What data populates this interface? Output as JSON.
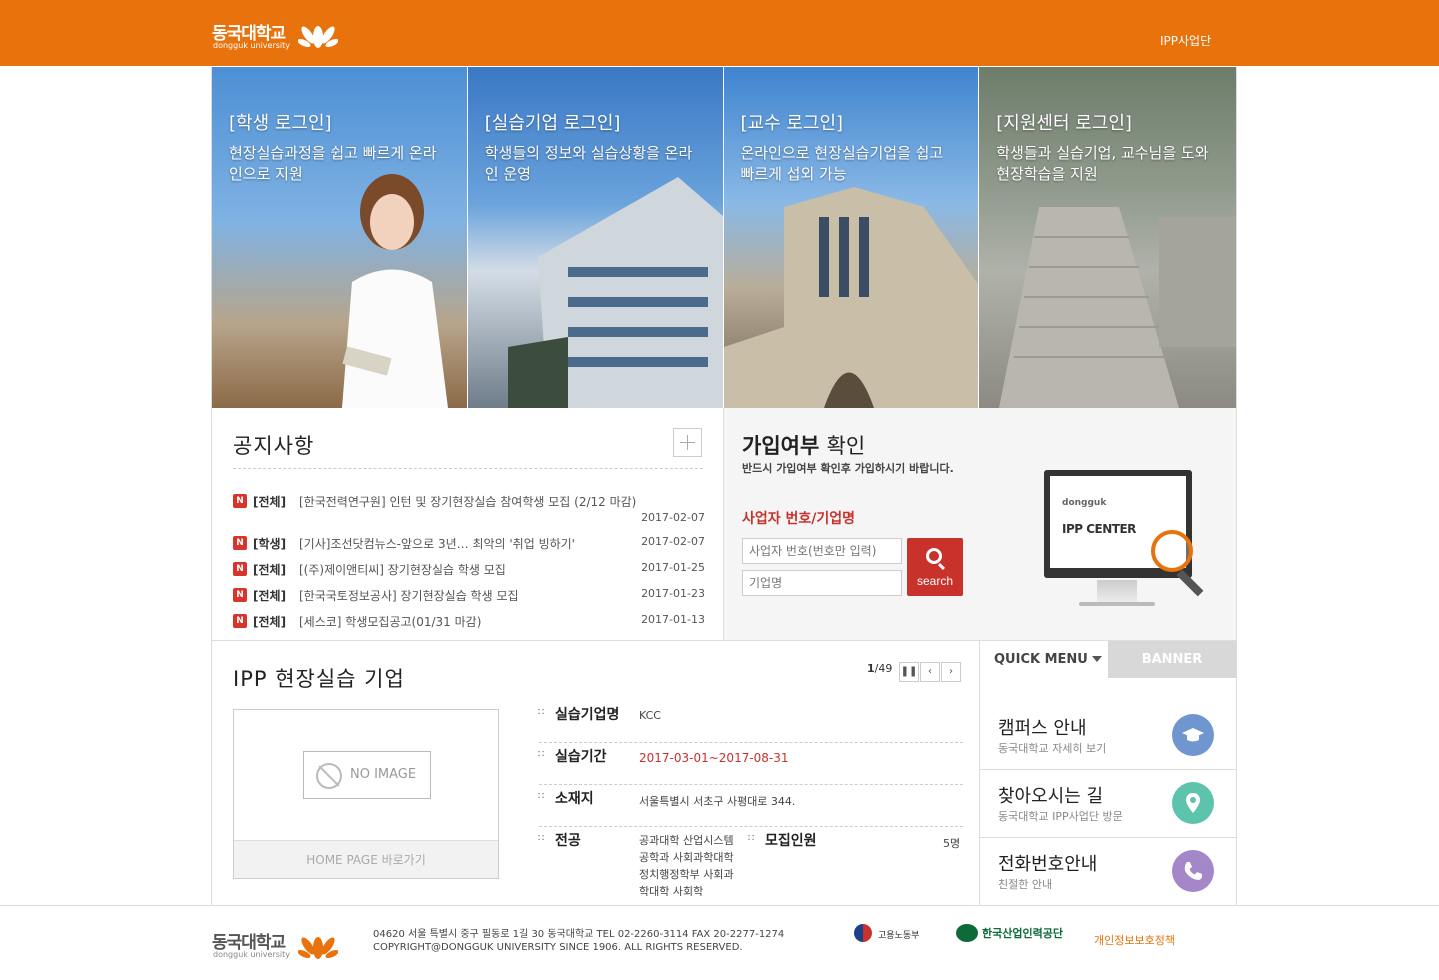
{
  "header": {
    "logo_ko": "동국대학교",
    "logo_en": "dongguk university",
    "top_link": "IPP사업단",
    "accent_color": "#e8720c"
  },
  "hero": [
    {
      "title": "[학생 로그인]",
      "desc": "현장실습과정을 쉽고 빠르게 온라인으로 지원"
    },
    {
      "title": "[실습기업 로그인]",
      "desc": "학생들의 정보와 실습상황을 온라인 운영"
    },
    {
      "title": "[교수 로그인]",
      "desc": "온라인으로 현장실습기업을 쉽고 빠르게 섭외 가능"
    },
    {
      "title": "[지원센터 로그인]",
      "desc": "학생들과 실습기업, 교수님을 도와 현장학습을 지원"
    }
  ],
  "notice": {
    "title": "공지사항",
    "badge": "N",
    "items": [
      {
        "cat": "[전체]",
        "title": "[한국전력연구원] 인턴 및 장기현장실습 참여학생 모집 (2/12 마감)",
        "date": "2017-02-07"
      },
      {
        "cat": "[학생]",
        "title": "[기사]조선닷컴뉴스-앞으로 3년… 최악의 '취업 빙하기'",
        "date": "2017-02-07"
      },
      {
        "cat": "[전체]",
        "title": "[(주)제이앤티씨] 장기현장실습 학생 모집",
        "date": "2017-01-25"
      },
      {
        "cat": "[전체]",
        "title": "[한국국토정보공사] 장기현장실습 학생 모집",
        "date": "2017-01-23"
      },
      {
        "cat": "[전체]",
        "title": "[세스코] 학생모집공고(01/31 마감)",
        "date": "2017-01-13"
      }
    ]
  },
  "join": {
    "title_bold": "가입여부",
    "title_rest": "확인",
    "subtitle": "반드시 가입여부 확인후 가입하시기 바랍니다.",
    "biz_label": "사업자 번호/기업명",
    "input1_placeholder": "사업자 번호(번호만 입력)",
    "input2_placeholder": "기업명",
    "search_label": "search",
    "monitor_line1": "dongguk",
    "monitor_line2": "IPP CENTER"
  },
  "company": {
    "title": "IPP 현장실습 기업",
    "pager_current": "1",
    "pager_total": "/49",
    "no_image": "NO IMAGE",
    "homepage_btn": "HOME PAGE 바로가기",
    "fields": {
      "name_label": "실습기업명",
      "name": "KCC",
      "period_label": "실습기간",
      "period": "2017-03-01~2017-08-31",
      "location_label": "소재지",
      "location": "서울특별시 서초구 사평대로 344.",
      "major_label": "전공",
      "major": "공과대학 산업시스템공학과 사회과학대학 정치행정학부 사회과학대학 사회학",
      "recruit_label": "모집인원",
      "recruit": "5명"
    }
  },
  "quick": {
    "tab1": "QUICK MENU",
    "tab2": "BANNER",
    "items": [
      {
        "title": "캠퍼스 안내",
        "sub": "동국대학교 자세히 보기",
        "color": "#6f96cf"
      },
      {
        "title": "찾아오시는 길",
        "sub": "동국대학교 IPP사업단 방문",
        "color": "#5cc3ad"
      },
      {
        "title": "전화번호안내",
        "sub": "친절한 안내",
        "color": "#a487c9"
      }
    ]
  },
  "footer": {
    "logo_ko": "동국대학교",
    "logo_en": "dongguk university",
    "address": "04620 서울 특별시 중구 필동로 1길 30 동국대학교 TEL 02-2260-3114 FAX 20-2277-1274",
    "copyright": "COPYRIGHT@DONGGUK UNIVERSITY SINCE 1906. ALL RIGHTS RESERVED.",
    "ministry": "고용노동부",
    "hrd": "한국산업인력공단",
    "privacy": "개인정보보호정책"
  }
}
